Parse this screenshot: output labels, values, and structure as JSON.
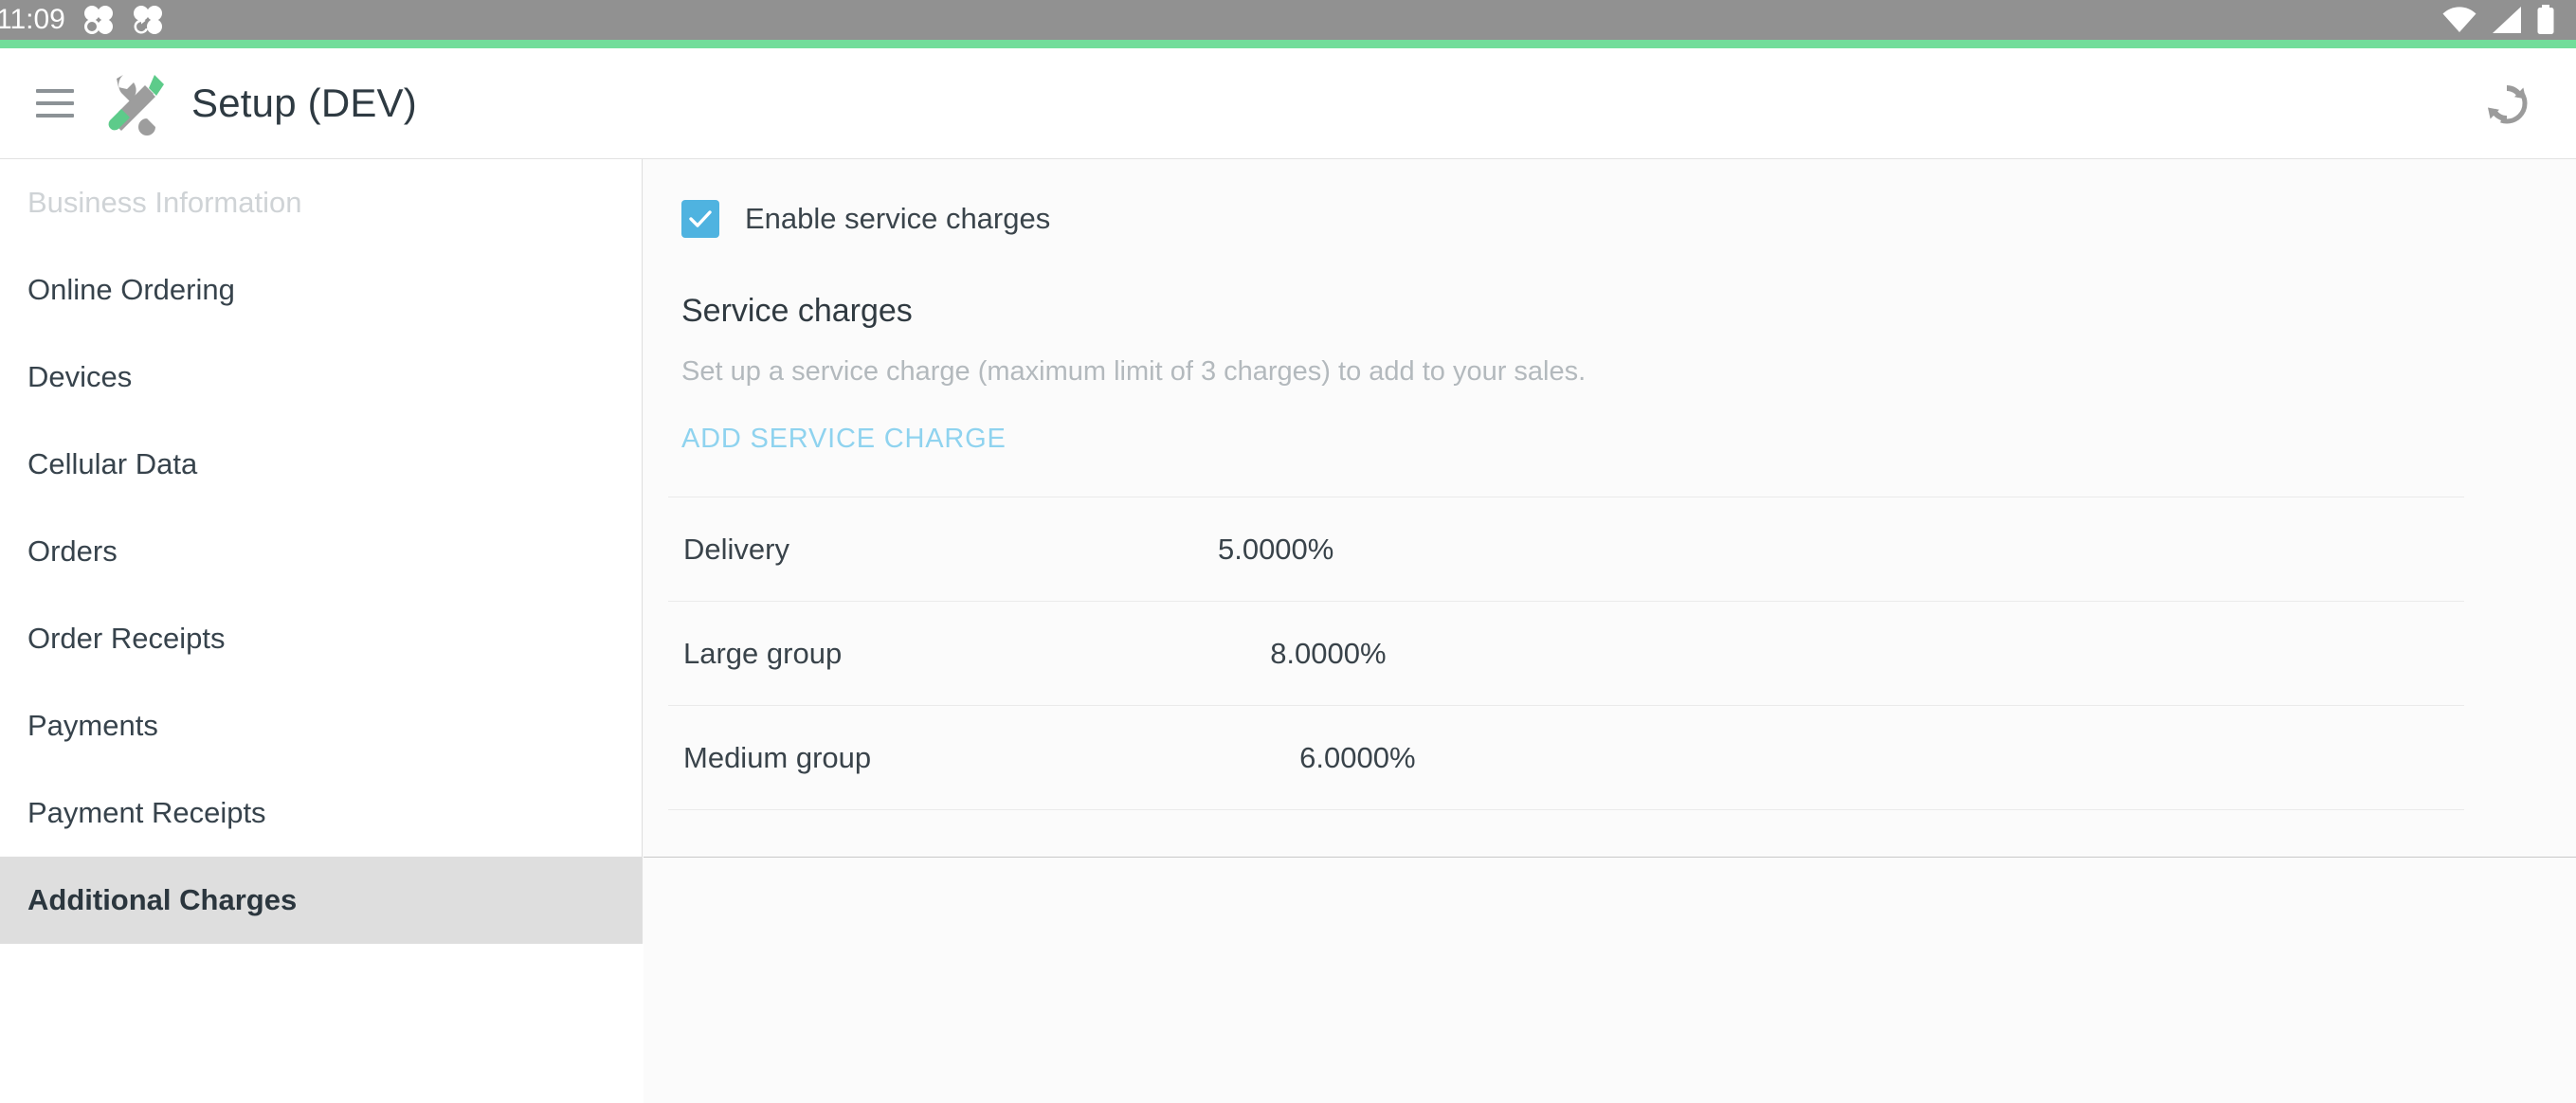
{
  "status_bar": {
    "clock": "11:09",
    "left_icons": [
      "clover-notification-icon",
      "clover-sync-notification-icon"
    ],
    "right_icons": [
      "wifi-icon",
      "cellular-signal-icon",
      "battery-icon"
    ],
    "background_color": "#919191"
  },
  "accent": {
    "color": "#72dd9a"
  },
  "app_bar": {
    "menu_icon": "hamburger-menu-icon",
    "logo_icon": "tools-setup-icon",
    "title": "Setup (DEV)",
    "refresh_icon": "refresh-sync-icon"
  },
  "sidebar": {
    "items": [
      {
        "label": "Business Information",
        "state": "muted"
      },
      {
        "label": "Online Ordering",
        "state": "normal"
      },
      {
        "label": "Devices",
        "state": "normal"
      },
      {
        "label": "Cellular Data",
        "state": "normal"
      },
      {
        "label": "Orders",
        "state": "normal"
      },
      {
        "label": "Order Receipts",
        "state": "normal"
      },
      {
        "label": "Payments",
        "state": "normal"
      },
      {
        "label": "Payment Receipts",
        "state": "normal"
      },
      {
        "label": "Additional Charges",
        "state": "selected"
      }
    ],
    "selected_background": "#dedede"
  },
  "main": {
    "enable_checkbox": {
      "label": "Enable service charges",
      "checked": true,
      "color": "#4fb3e0"
    },
    "section_title": "Service charges",
    "section_description": "Set up a service charge (maximum limit of 3 charges) to add to your sales.",
    "add_button_label": "ADD SERVICE CHARGE",
    "add_button_color": "#8fd3ef",
    "charges": [
      {
        "name": "Delivery",
        "value": "5.0000%"
      },
      {
        "name": "Large group",
        "value": "8.0000%"
      },
      {
        "name": "Medium group",
        "value": "6.0000%"
      }
    ]
  }
}
